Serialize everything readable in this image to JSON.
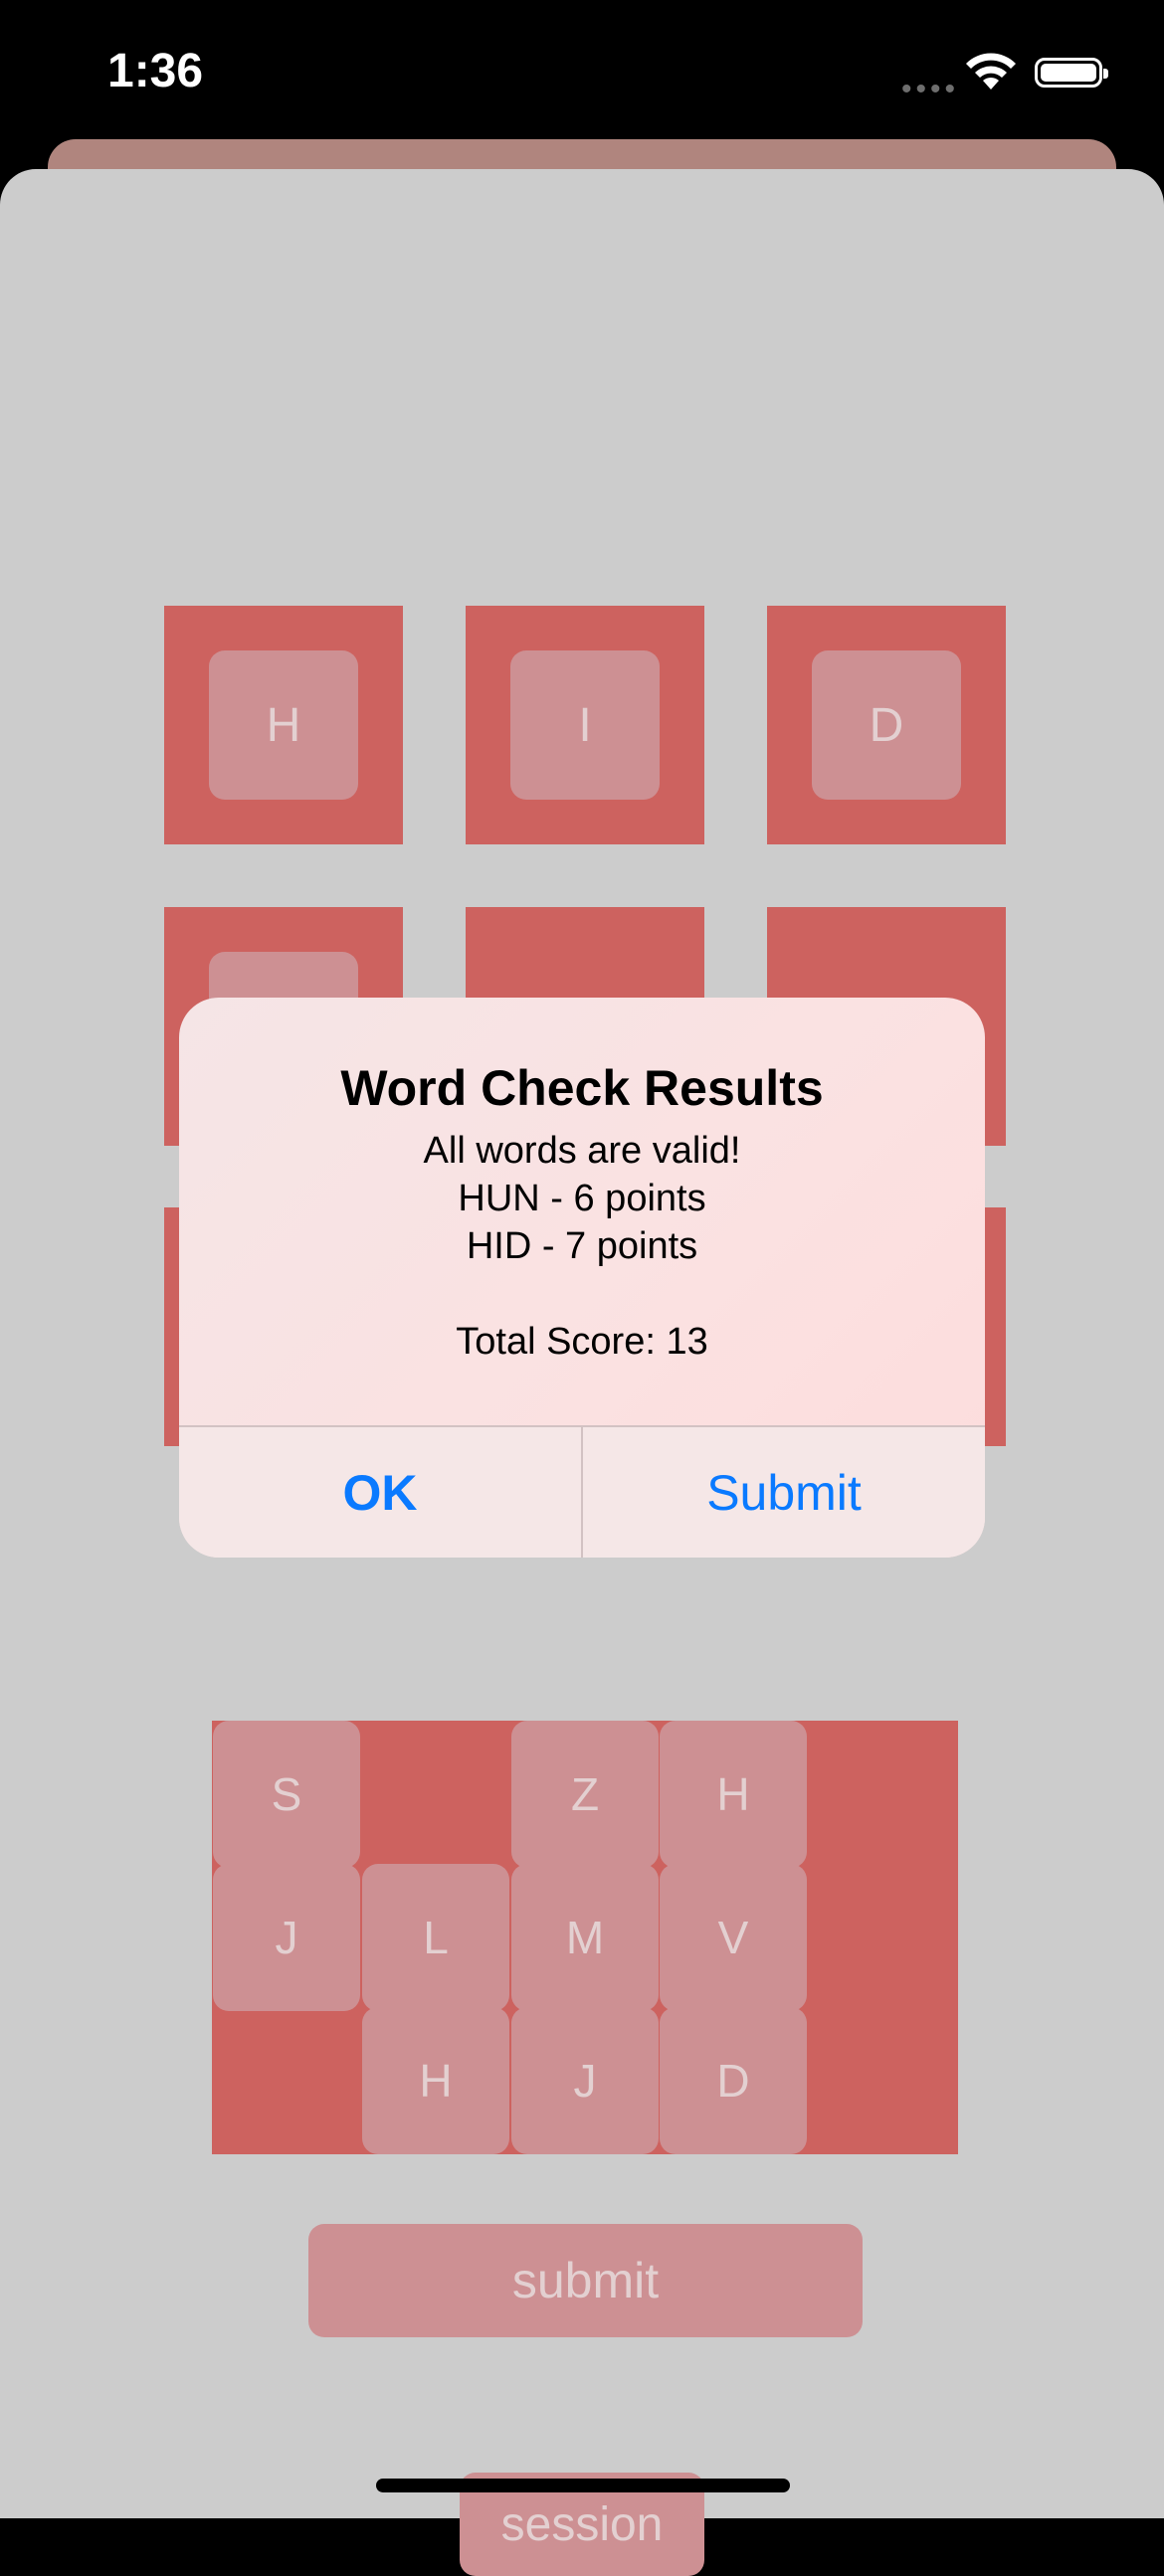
{
  "status_bar": {
    "time": "1:36",
    "signal": "••••"
  },
  "board": {
    "row1": [
      "H",
      "I",
      "D"
    ]
  },
  "rack": {
    "row1": [
      "S",
      "Z",
      "H"
    ],
    "row2": [
      "J",
      "L",
      "M",
      "V"
    ],
    "row3": [
      "H",
      "J",
      "D"
    ]
  },
  "buttons": {
    "submit": "submit",
    "session": "session"
  },
  "alert": {
    "title": "Word Check Results",
    "lines": [
      "All words are valid!",
      "HUN - 6 points",
      "HID - 7 points"
    ],
    "total": "Total Score: 13",
    "ok": "OK",
    "submit": "Submit"
  },
  "colors": {
    "tile": "#cd625f",
    "key": "#cd9093",
    "accent": "#0a7aff",
    "background": "#cccccc"
  }
}
